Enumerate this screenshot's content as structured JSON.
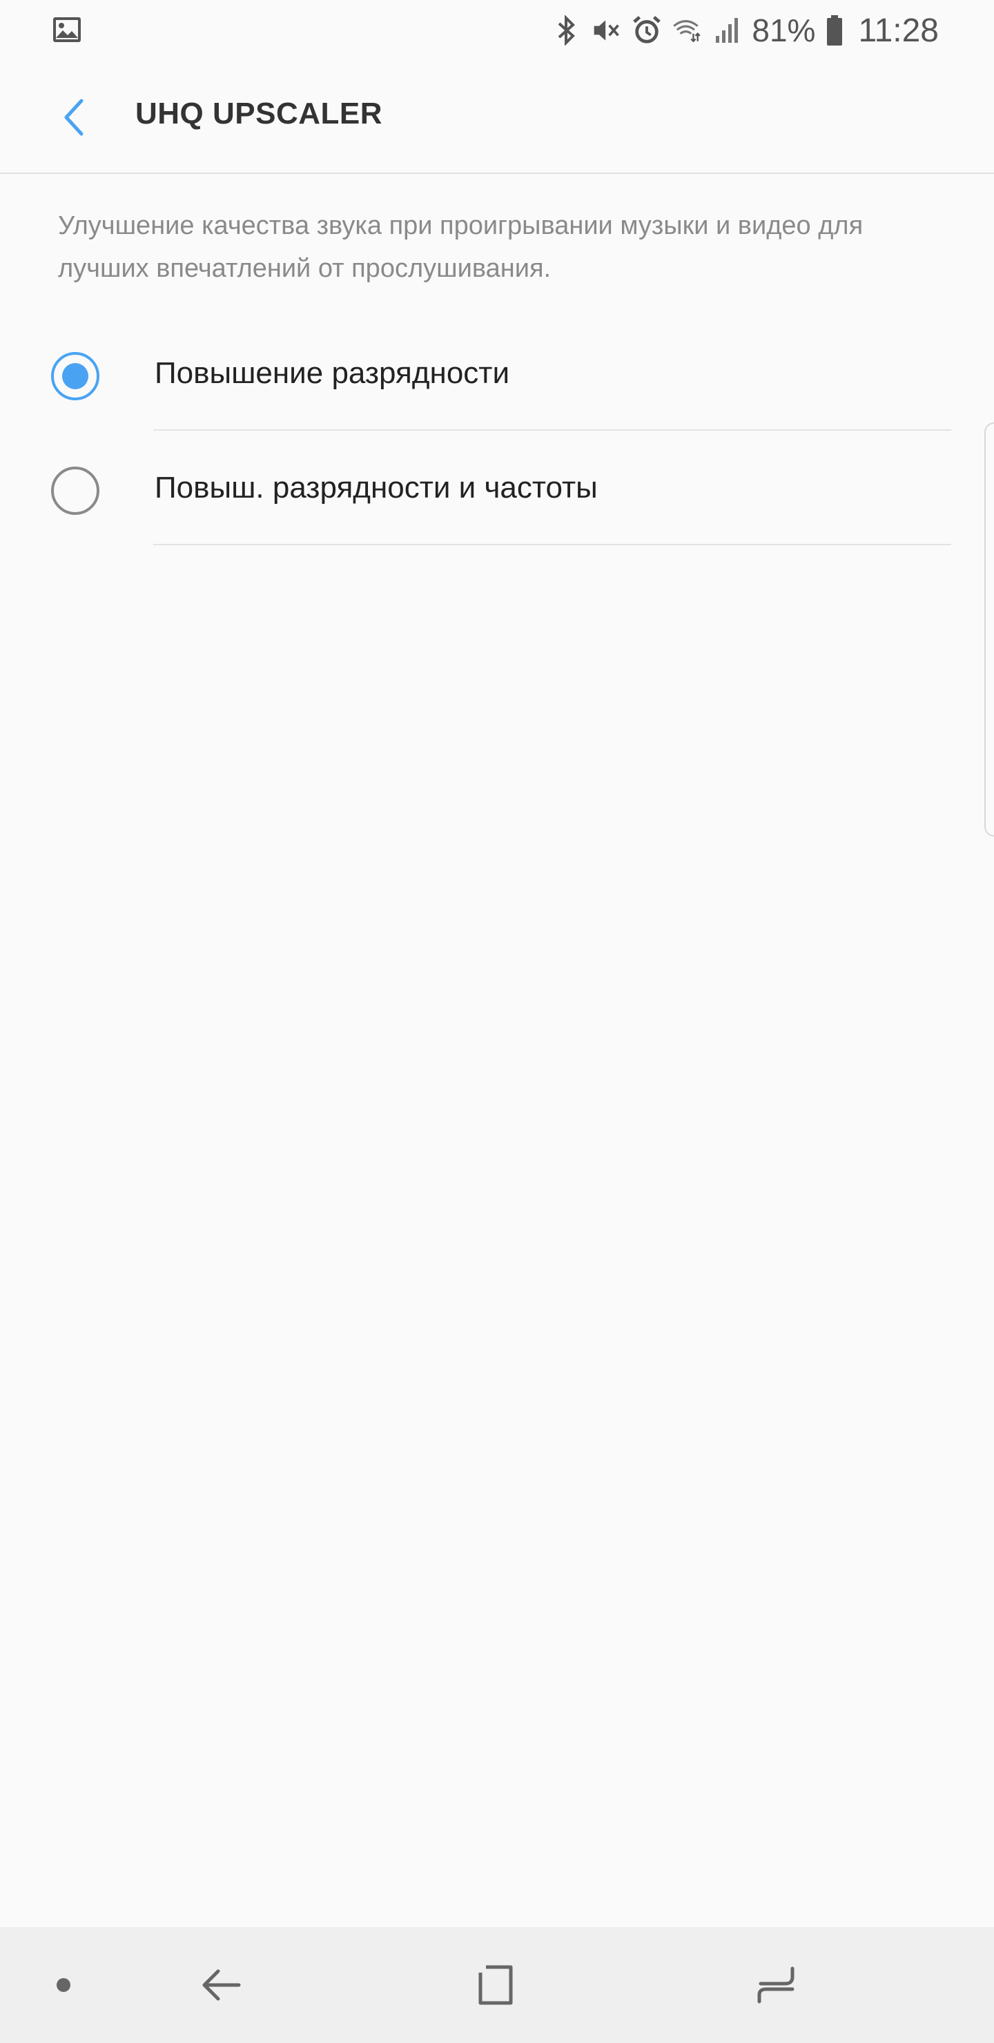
{
  "status_bar": {
    "left_icon": "image-icon",
    "icons": [
      "bluetooth-icon",
      "mute-icon",
      "alarm-icon",
      "wifi-icon",
      "signal-icon"
    ],
    "battery_text": "81%",
    "battery_icon": "battery-icon",
    "time": "11:28"
  },
  "app_bar": {
    "back_icon": "back-chevron-icon",
    "title": "UHQ UPSCALER"
  },
  "description": "Улучшение качества звука при проигрывании музыки и видео для лучших впечатлений от прослушивания.",
  "options": [
    {
      "label": "Повышение разрядности",
      "selected": true
    },
    {
      "label": "Повыш. разрядности и частоты",
      "selected": false
    }
  ],
  "navigation_bar": {
    "items": [
      "nav-dot-icon",
      "nav-back-icon",
      "nav-home-icon",
      "nav-recents-icon"
    ]
  },
  "colors": {
    "accent": "#4aa3f2",
    "background": "#fafafa",
    "nav_background": "#efefef"
  }
}
